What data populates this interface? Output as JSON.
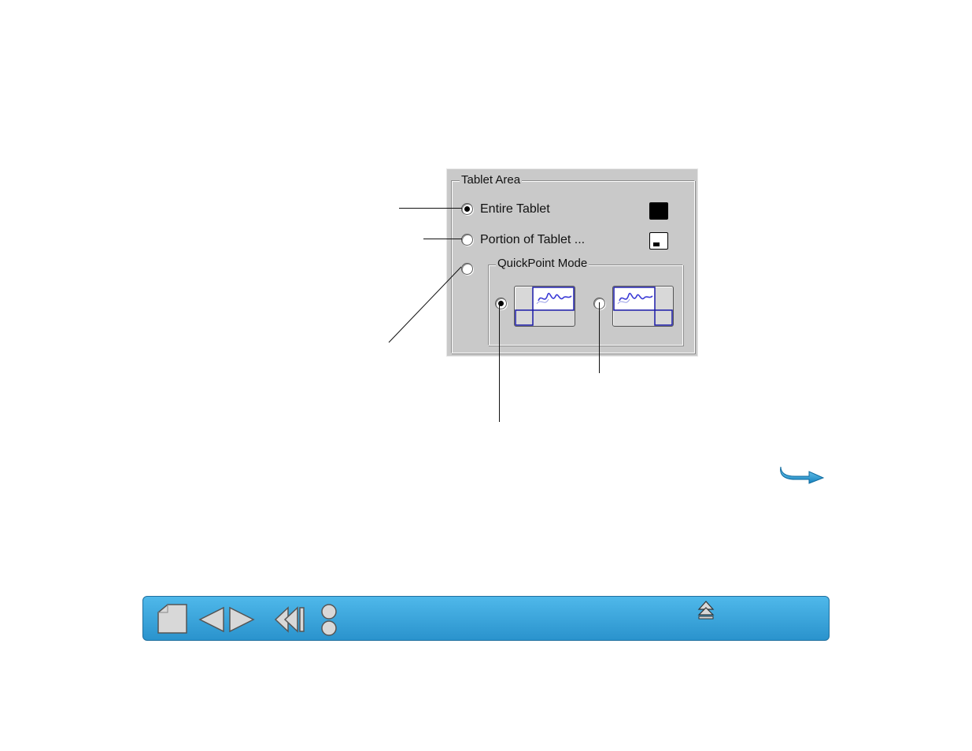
{
  "tablet_area": {
    "title": "Tablet Area",
    "options": [
      {
        "label": "Entire Tablet",
        "checked": true
      },
      {
        "label": "Portion of Tablet ...",
        "checked": false
      },
      {
        "label": "",
        "checked": false
      }
    ],
    "quickpoint": {
      "title": "QuickPoint Mode",
      "options": [
        {
          "checked": true,
          "region": "bottom-left"
        },
        {
          "checked": false,
          "region": "bottom-right"
        }
      ]
    }
  },
  "colors": {
    "panel_bg": "#c9c9c9",
    "nav_blue": "#2a93cd",
    "icon_blue": "#1a1aa8",
    "arrow_blue": "#1ea3dc"
  },
  "icons": {
    "entire_tablet": "filled-square-icon",
    "portion_tablet": "partial-square-icon",
    "next": "next-page-arrow-icon",
    "home": "home-icon",
    "back": "back-arrow-icon",
    "forward": "forward-arrow-icon",
    "first": "first-page-icon",
    "info": "info-icon",
    "eject": "eject-icon"
  }
}
